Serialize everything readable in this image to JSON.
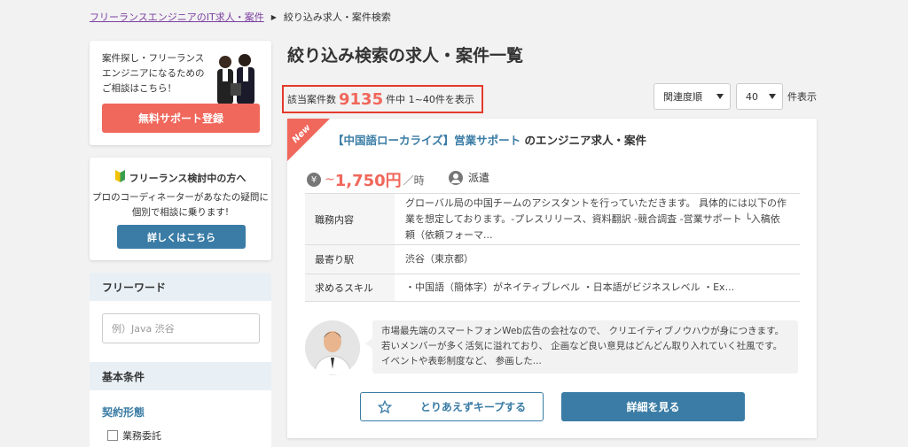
{
  "breadcrumb": {
    "home": "フリーランスエンジニアのIT求人・案件",
    "current": "絞り込み求人・案件検索"
  },
  "promo": {
    "text": "案件探し・フリーランスエンジニアになるためのご相談はこちら！",
    "button": "無料サポート登録"
  },
  "consider": {
    "title": "フリーランス検討中の方へ",
    "description": "プロのコーディネーターがあなたの疑問に個別で相談に乗ります!",
    "button": "詳しくはこちら"
  },
  "search": {
    "freeword_heading": "フリーワード",
    "freeword_placeholder": "例）Java 渋谷",
    "basic_heading": "基本条件",
    "contract_label": "契約形態",
    "contract_option": "業務委託"
  },
  "main": {
    "title": "絞り込み検索の求人・案件一覧",
    "count_prefix": "該当案件数",
    "count": "9135",
    "count_suffix": "件中 1~40件を表示",
    "sort_value": "関連度順",
    "perpage_value": "40",
    "perpage_suffix": "件表示"
  },
  "job": {
    "badge": "New",
    "title_link": "【中国語ローカライズ】営業サポート",
    "title_suffix": "のエンジニア求人・案件",
    "pay_prefix": "~",
    "pay_value": "1,750円",
    "pay_unit": "／時",
    "employment": "派遣",
    "rows": [
      {
        "label": "職務内容",
        "value": "グローバル局の中国チームのアシスタントを行っていただきます。 具体的には以下の作業を想定しております。-プレスリリース、資料翻訳 -競合調査 -営業サポート └入稿依頼（依頼フォーマ..."
      },
      {
        "label": "最寄り駅",
        "value": "渋谷（東京都）"
      },
      {
        "label": "求めるスキル",
        "value": "・中国語（簡体字）がネイティブレベル ・日本語がビジネスレベル ・Ex..."
      }
    ],
    "comment": "市場最先端のスマートフォンWeb広告の会社なので、 クリエイティブノウハウが身につきます。 若いメンバーが多く活気に溢れており、 企画など良い意見はどんどん取り入れていく社風です。 イベントや表彰制度など、 参画した...",
    "keep_button": "とりあえずキープする",
    "detail_button": "詳細を見る"
  }
}
